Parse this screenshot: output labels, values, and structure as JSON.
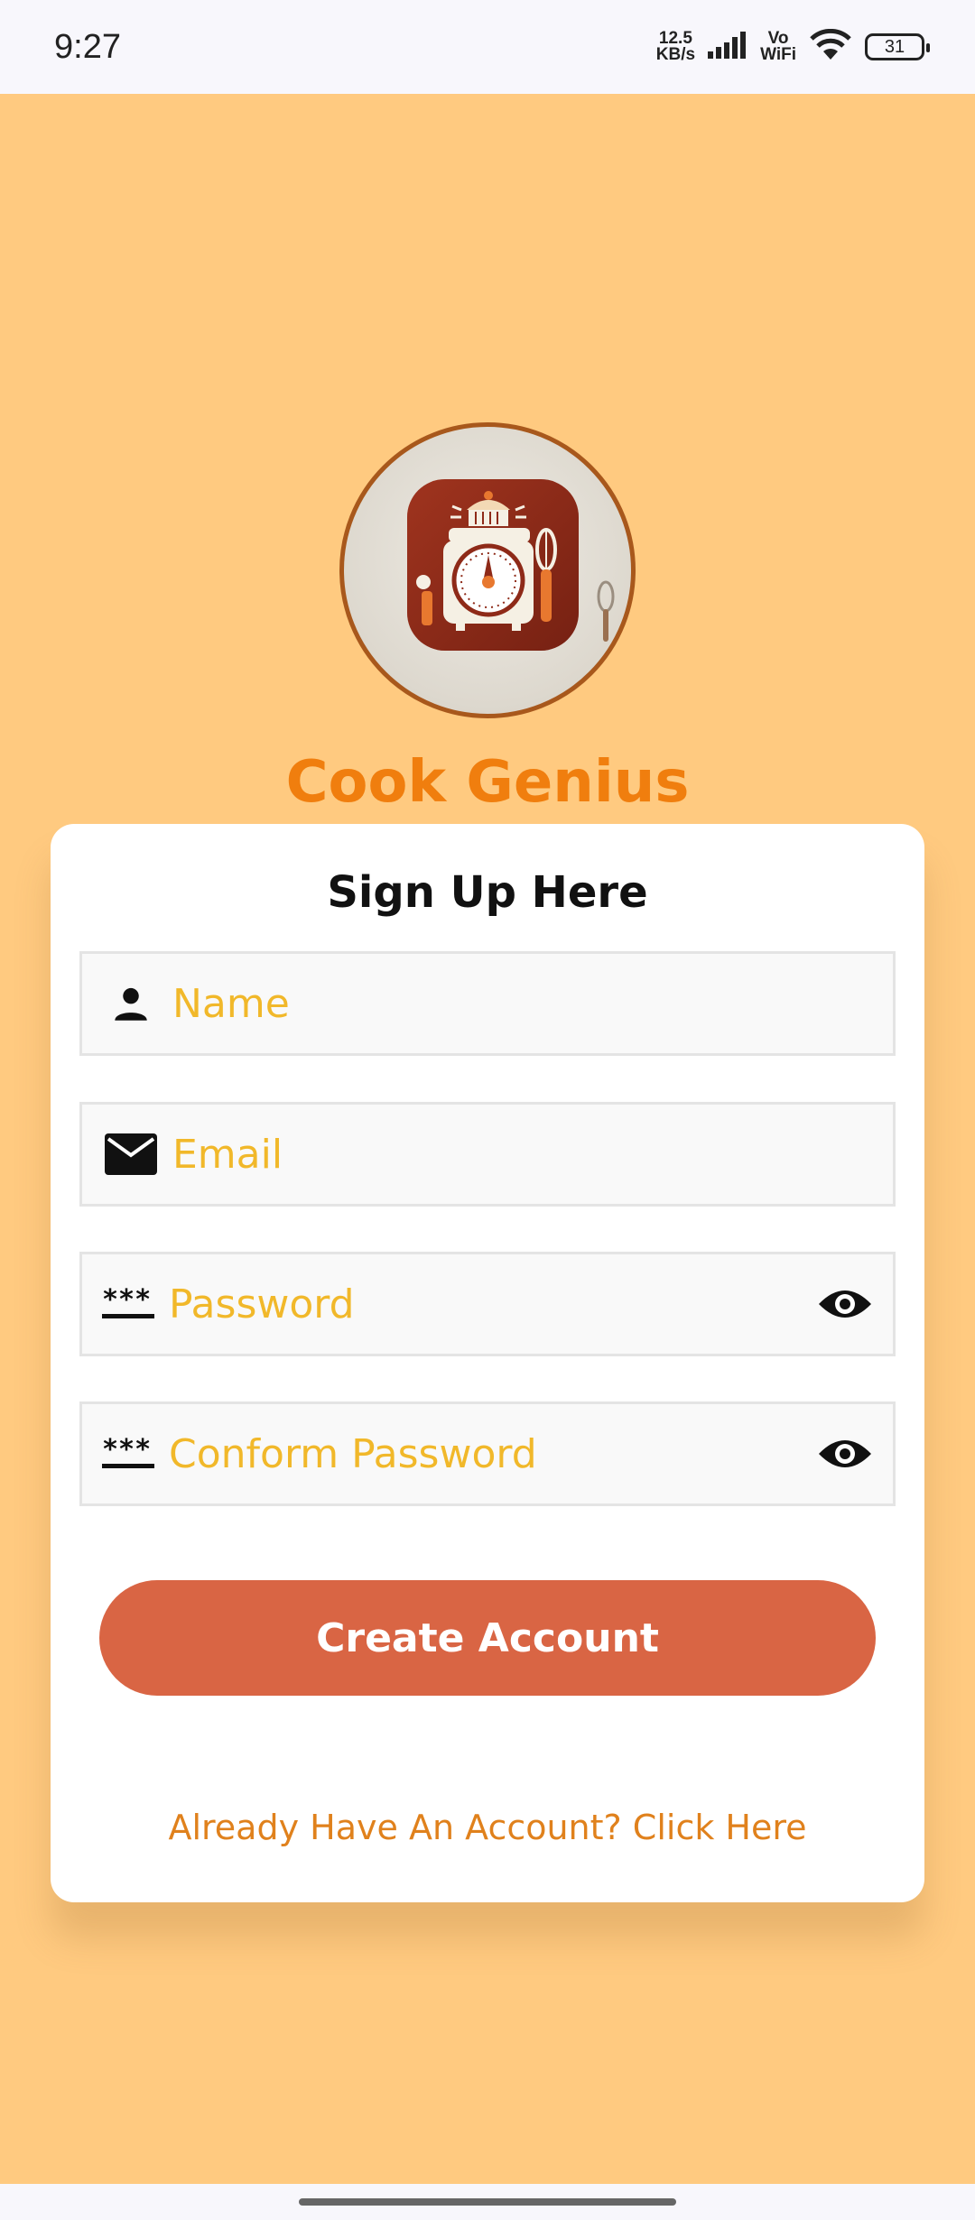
{
  "status_bar": {
    "time": "9:27",
    "net_speed_value": "12.5",
    "net_speed_unit": "KB/s",
    "vo": "Vo",
    "wifi": "WiFi",
    "battery": "31"
  },
  "app": {
    "title": "Cook Genius"
  },
  "form": {
    "title": "Sign Up Here",
    "name_placeholder": "Name",
    "email_placeholder": "Email",
    "password_placeholder": "Password",
    "confirm_placeholder": "Conform Password",
    "submit_label": "Create Account",
    "login_link": "Already Have An Account? Click Here"
  },
  "colors": {
    "background": "#FFCA80",
    "accent": "#F07E0E",
    "button": "#D96544",
    "placeholder": "#F1B82A",
    "link": "#E0811C"
  },
  "icons": {
    "name": "person-icon",
    "email": "mail-icon",
    "password": "password-icon",
    "visibility": "eye-icon"
  }
}
